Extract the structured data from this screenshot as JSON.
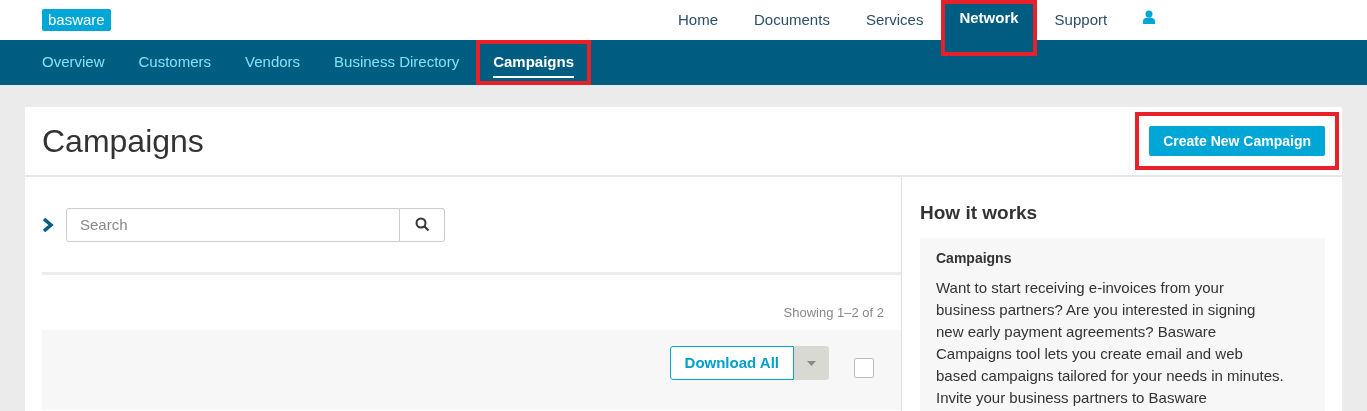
{
  "header": {
    "logo": "basware",
    "nav": [
      {
        "label": "Home",
        "selected": false,
        "highlighted": false
      },
      {
        "label": "Documents",
        "selected": false,
        "highlighted": false
      },
      {
        "label": "Services",
        "selected": false,
        "highlighted": false
      },
      {
        "label": "Network",
        "selected": true,
        "highlighted": true
      },
      {
        "label": "Support",
        "selected": false,
        "highlighted": false
      }
    ]
  },
  "subnav": [
    {
      "label": "Overview",
      "selected": false,
      "highlighted": false
    },
    {
      "label": "Customers",
      "selected": false,
      "highlighted": false
    },
    {
      "label": "Vendors",
      "selected": false,
      "highlighted": false
    },
    {
      "label": "Business Directory",
      "selected": false,
      "highlighted": false
    },
    {
      "label": "Campaigns",
      "selected": true,
      "highlighted": true
    }
  ],
  "page": {
    "title": "Campaigns",
    "create_button": {
      "label": "Create New Campaign",
      "highlighted": true
    }
  },
  "search": {
    "placeholder": "Search"
  },
  "results": {
    "count": "Showing 1–2 of 2",
    "download_button": "Download All",
    "select_all_checked": false
  },
  "how_it_works": {
    "title": "How it works",
    "box_title": "Campaigns",
    "text": "Want to start receiving e-invoices from your business partners? Are you interested in signing new early payment agreements? Basware Campaigns tool lets you create email and web based campaigns tailored for your needs in minutes. Invite your business partners to Basware"
  }
}
